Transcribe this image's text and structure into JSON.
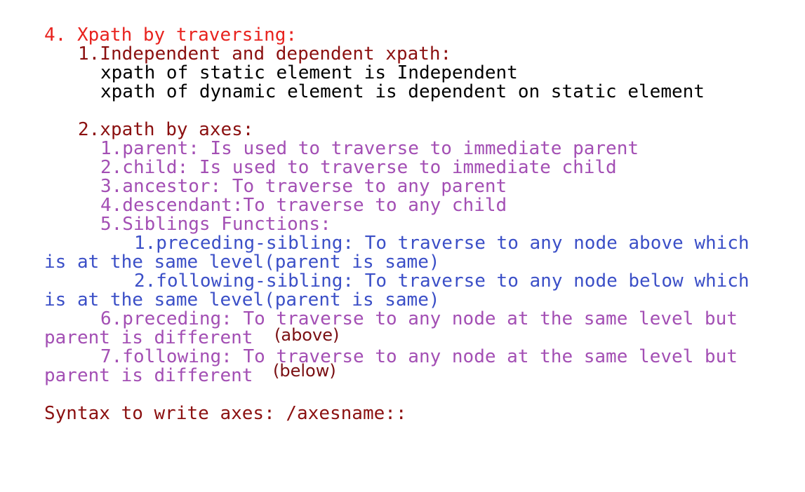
{
  "heading": "4. Xpath by traversing:",
  "section1": {
    "title": "1.Independent and dependent xpath:",
    "lines": [
      "xpath of static element is Independent",
      "xpath of dynamic element is dependent on static element"
    ]
  },
  "section2": {
    "title": "2.xpath by axes:",
    "items": [
      "1.parent: Is used to traverse to immediate parent",
      "2.child: Is used to traverse to immediate child",
      "3.ancestor: To traverse to any parent",
      "4.descendant:To traverse to any child",
      "5.Siblings Functions:"
    ],
    "siblings": [
      {
        "first": "1.preceding-sibling: To traverse to any node above which",
        "wrap": "is at the same level(parent is same)"
      },
      {
        "first": "2.following-sibling: To traverse to any node below which",
        "wrap": "is at the same level(parent is same)"
      }
    ],
    "more": [
      {
        "first": "6.preceding: To traverse to any node at the same level but",
        "wrap": "parent is different",
        "note": "(above)"
      },
      {
        "first": "7.following: To traverse to any node at the same level but",
        "wrap": "parent is different",
        "note": "(below)"
      }
    ]
  },
  "syntax": "Syntax to write axes: /axesname::"
}
